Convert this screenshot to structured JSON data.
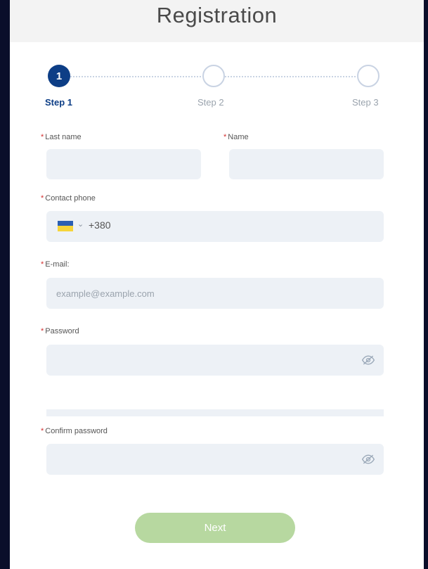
{
  "header": {
    "title": "Registration"
  },
  "stepper": {
    "steps": [
      {
        "number": "1",
        "label": "Step 1",
        "active": true
      },
      {
        "number": "",
        "label": "Step 2",
        "active": false
      },
      {
        "number": "",
        "label": "Step 3",
        "active": false
      }
    ]
  },
  "form": {
    "required_mark": "*",
    "last_name": {
      "label": "Last name",
      "value": "",
      "placeholder": ""
    },
    "name": {
      "label": "Name",
      "value": "",
      "placeholder": ""
    },
    "phone": {
      "label": "Contact phone",
      "prefix": "+380",
      "country_flag": "ukraine-flag-icon"
    },
    "email": {
      "label": "E-mail:",
      "value": "",
      "placeholder": "example@example.com"
    },
    "password": {
      "label": "Password",
      "value": ""
    },
    "confirm_password": {
      "label": "Confirm password",
      "value": ""
    }
  },
  "actions": {
    "next_label": "Next"
  },
  "colors": {
    "primary": "#0d3e86",
    "field_bg": "#edf1f6",
    "button_disabled": "#b7d8a0",
    "required": "#d32f2f"
  }
}
